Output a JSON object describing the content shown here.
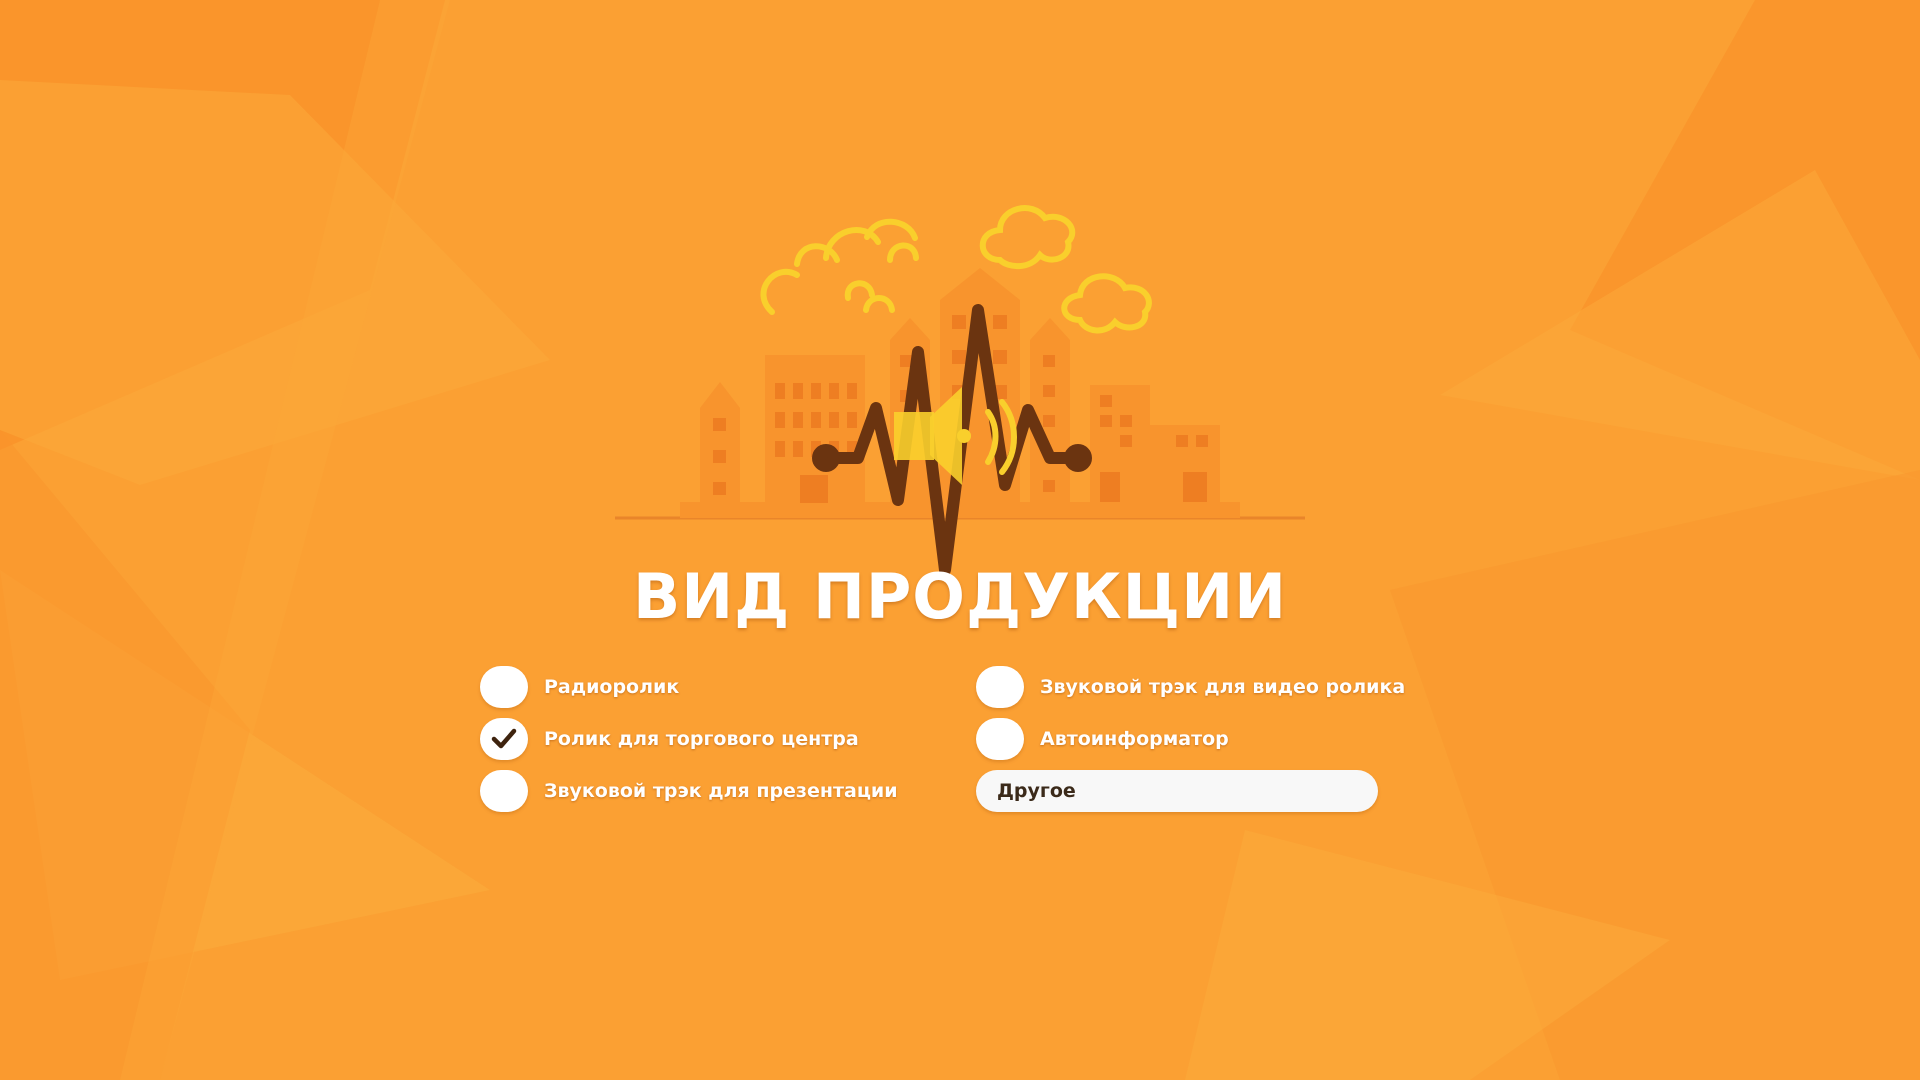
{
  "page": {
    "title": "ВИД ПРОДУКЦИИ"
  },
  "colors": {
    "background": "#fba033",
    "accent_dark": "#6b3410",
    "accent_yellow": "#f9cf2c",
    "checkbox": "#ffffff"
  },
  "illustration": {
    "icons": [
      "clouds",
      "city-buildings",
      "sound-wave",
      "megaphone"
    ]
  },
  "options": [
    {
      "label": "Радиоролик",
      "checked": false
    },
    {
      "label": "Ролик для торгового центра",
      "checked": true
    },
    {
      "label": "Звуковой трэк для презентации",
      "checked": false
    },
    {
      "label": "Звуковой трэк для видео ролика",
      "checked": false
    },
    {
      "label": "Автоинформатор",
      "checked": false
    }
  ],
  "other_field": {
    "placeholder": "Другое",
    "value": ""
  }
}
